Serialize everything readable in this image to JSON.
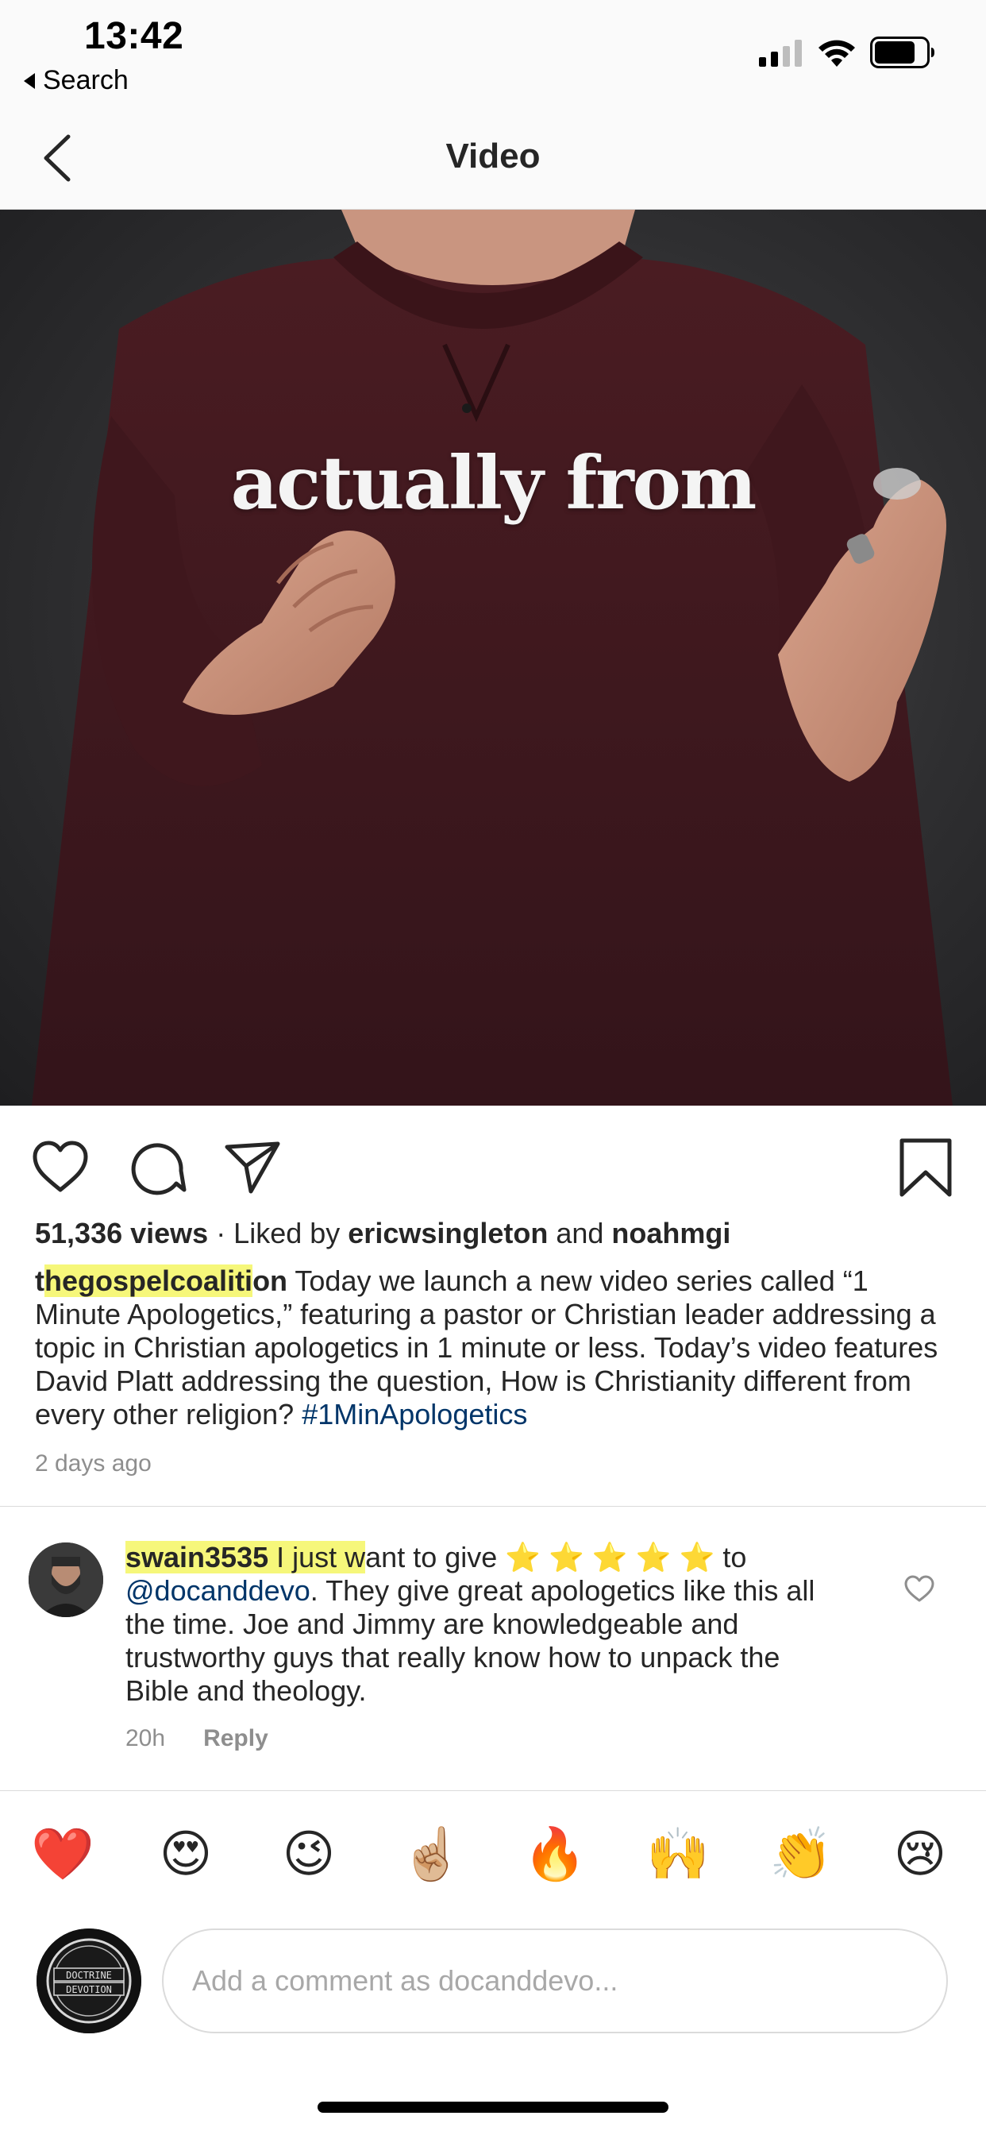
{
  "status_bar": {
    "time": "13:42",
    "back_app": "Search",
    "signal_icon": "signal-bars-icon",
    "wifi_icon": "wifi-icon",
    "battery_icon": "battery-icon"
  },
  "header": {
    "title": "Video",
    "back_icon": "chevron-left-icon"
  },
  "video": {
    "overlay_text": "actually from"
  },
  "actions": {
    "like_icon": "heart-icon",
    "comment_icon": "comment-bubble-icon",
    "share_icon": "paper-plane-icon",
    "save_icon": "bookmark-icon"
  },
  "post": {
    "views": "51,336 views",
    "liked_by_prefix": " · Liked by ",
    "liked_user_1": "ericwsingleton",
    "liked_and": " and ",
    "liked_user_2": "noahmgi",
    "caption_user_start": "t",
    "caption_user_highlight": "hegospelcoaliti",
    "caption_user_end": "on",
    "caption_text": " Today we launch a new video series called “1 Minute Apologetics,” featuring a pastor or Christian leader addressing a topic in Christian apologetics in 1 minute or less. Today’s video features David Platt addressing the question, How is Christianity different from every other religion? ",
    "hashtag": "#1MinApologetics",
    "time_ago": "2 days ago"
  },
  "comment": {
    "username": "swain3535",
    "highlight_text": " I just w",
    "text_before_stars": "ant to give ",
    "stars": "⭐ ⭐ ⭐ ⭐ ⭐",
    "text_after_stars": " to ",
    "mention": "@docanddevo",
    "text_rest": ". They give great apologetics like this all the time. Joe and Jimmy are knowledgeable and trustworthy guys that really know how to unpack the Bible and theology.",
    "time": "20h",
    "reply_label": "Reply",
    "like_icon": "small-heart-icon"
  },
  "emoji_bar": [
    "❤️",
    "😍",
    "😉",
    "☝🏼",
    "🔥",
    "🙌",
    "👏",
    "😢"
  ],
  "composer": {
    "placeholder": "Add a comment as docanddevo...",
    "avatar_text_1": "DOCTRINE",
    "avatar_text_2": "DEVOTION"
  },
  "colors": {
    "link": "#003569",
    "highlight": "#f6f77a",
    "muted": "#8e8e8e",
    "text": "#262626"
  }
}
